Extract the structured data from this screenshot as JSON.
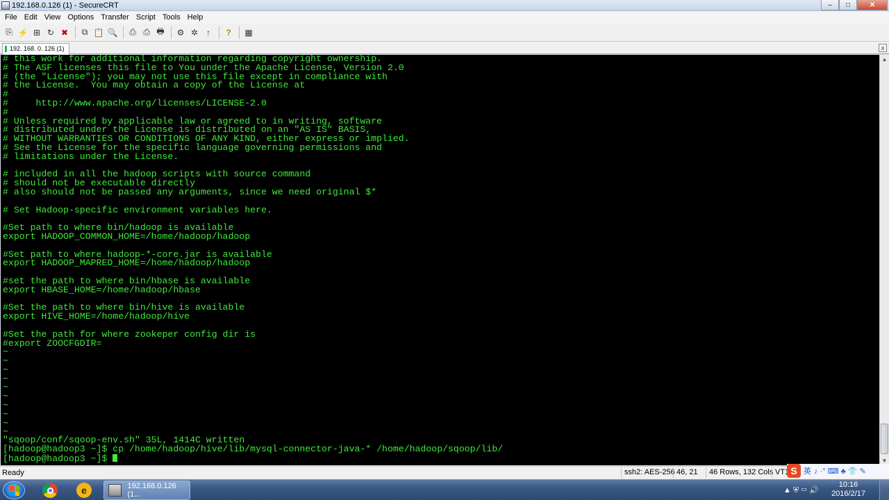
{
  "window": {
    "title": "192.168.0.126 (1) - SecureCRT",
    "app_icon": "securecrt-icon",
    "minimize": "‒",
    "maximize": "□",
    "close": "✕"
  },
  "menu": [
    "File",
    "Edit",
    "View",
    "Options",
    "Transfer",
    "Script",
    "Tools",
    "Help"
  ],
  "toolbar": {
    "icons": [
      {
        "name": "connect-icon",
        "glyph": "⎘"
      },
      {
        "name": "quick-connect-icon",
        "glyph": "⚡"
      },
      {
        "name": "connect-in-tab-icon",
        "glyph": "⊞"
      },
      {
        "name": "reconnect-icon",
        "glyph": "↻"
      },
      {
        "name": "disconnect-icon",
        "glyph": "✖"
      },
      {
        "name": "copy-icon",
        "glyph": "⧉"
      },
      {
        "name": "paste-icon",
        "glyph": "📋"
      },
      {
        "name": "find-icon",
        "glyph": "🔍"
      },
      {
        "name": "print-icon",
        "glyph": "⎙"
      },
      {
        "name": "print-selection-icon",
        "glyph": "⎙"
      },
      {
        "name": "print-screen-icon",
        "glyph": "🖶"
      },
      {
        "name": "session-options-icon",
        "glyph": "⚙"
      },
      {
        "name": "global-options-icon",
        "glyph": "✲"
      },
      {
        "name": "sftp-icon",
        "glyph": "↑"
      },
      {
        "name": "help-icon",
        "glyph": "?"
      },
      {
        "name": "keymap-icon",
        "glyph": "▦"
      }
    ]
  },
  "tab": {
    "label": "192. 168. 0. 126  (1)",
    "close": "x"
  },
  "terminal": {
    "lines_top": [
      "# this work for additional information regarding copyright ownership.",
      "# The ASF licenses this file to You under the Apache License, Version 2.0",
      "# (the \"License\"); you may not use this file except in compliance with",
      "# the License.  You may obtain a copy of the License at",
      "#",
      "#     http://www.apache.org/licenses/LICENSE-2.0",
      "#",
      "# Unless required by applicable law or agreed to in writing, software",
      "# distributed under the License is distributed on an \"AS IS\" BASIS,",
      "# WITHOUT WARRANTIES OR CONDITIONS OF ANY KIND, either express or implied.",
      "# See the License for the specific language governing permissions and",
      "# limitations under the License.",
      "",
      "# included in all the hadoop scripts with source command",
      "# should not be executable directly",
      "# also should not be passed any arguments, since we need original $*",
      "",
      "# Set Hadoop-specific environment variables here.",
      "",
      "#Set path to where bin/hadoop is available",
      "export HADOOP_COMMON_HOME=/home/hadoop/hadoop",
      "",
      "#Set path to where hadoop-*-core.jar is available",
      "export HADOOP_MAPRED_HOME=/home/hadoop/hadoop",
      "",
      "#set the path to where bin/hbase is available",
      "export HBASE_HOME=/home/hadoop/hbase",
      "",
      "#Set the path to where bin/hive is available",
      "export HIVE_HOME=/home/hadoop/hive",
      "",
      "#Set the path for where zookeper config dir is",
      "#export ZOOCFGDIR=",
      "~",
      "~",
      "~",
      "~",
      "~",
      "~",
      "~",
      "~",
      "~",
      "~"
    ],
    "lines_bottom": [
      "\"sqoop/conf/sqoop-env.sh\" 35L, 1414C written",
      "[hadoop@hadoop3 ~]$ cp /home/hadoop/hive/lib/mysql-connector-java-* /home/hadoop/sqoop/lib/",
      "[hadoop@hadoop3 ~]$ "
    ]
  },
  "statusbar": {
    "ready": "Ready",
    "cipher": "ssh2: AES-256",
    "cursor": "46,  21",
    "size": "46 Rows, 132 Cols",
    "emulation": "VT1"
  },
  "ime": {
    "logo": "S",
    "lang": "英",
    "icons": "♪ ·° ⌨ ♣ 👕 ✎"
  },
  "taskbar": {
    "active_task": "192.168.0.126 (1...",
    "tray_icons": "▲  ⛨  ▭  🔊",
    "time": "10:16",
    "date": "2016/2/17"
  }
}
